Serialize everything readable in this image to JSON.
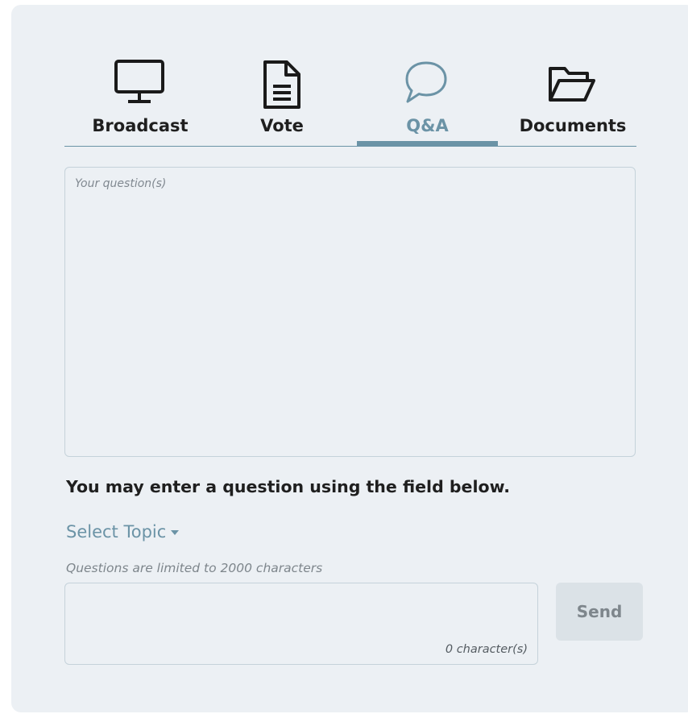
{
  "tabs": [
    {
      "label": "Broadcast",
      "icon": "monitor-icon",
      "active": false
    },
    {
      "label": "Vote",
      "icon": "document-icon",
      "active": false
    },
    {
      "label": "Q&A",
      "icon": "speech-bubble-icon",
      "active": true
    },
    {
      "label": "Documents",
      "icon": "folder-open-icon",
      "active": false
    }
  ],
  "questions_box": {
    "placeholder": "Your question(s)"
  },
  "instructions": "You may enter a question using the field below.",
  "topic_select": {
    "label": "Select Topic"
  },
  "limit_note": "Questions are limited to 2000 characters",
  "input": {
    "value": "",
    "char_count": "0 character(s)"
  },
  "send_label": "Send",
  "colors": {
    "accent": "#6b93a6",
    "panel_bg": "#ecf0f4",
    "text": "#1f1f1f",
    "muted": "#7e868c"
  }
}
